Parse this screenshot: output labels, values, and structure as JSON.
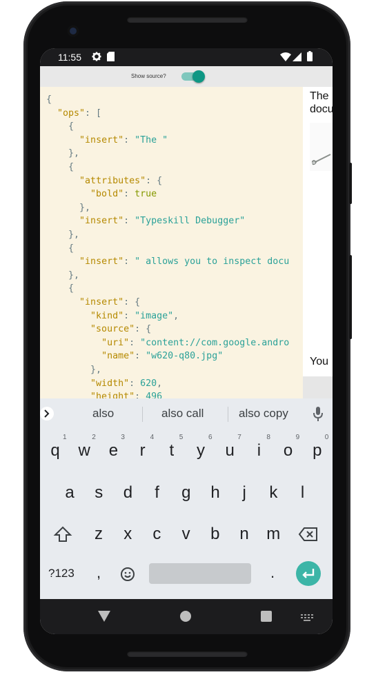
{
  "status": {
    "time": "11:55",
    "icons": [
      "settings-icon",
      "sd-card-icon",
      "wifi-icon",
      "signal-icon",
      "battery-icon"
    ]
  },
  "toggle": {
    "label": "Show source?",
    "checked": true,
    "accent": "#0e9784"
  },
  "source": {
    "lines": [
      [
        {
          "t": "{",
          "c": "p"
        }
      ],
      [
        {
          "t": "  ",
          "c": "p"
        },
        {
          "t": "\"ops\"",
          "c": "k"
        },
        {
          "t": ": [",
          "c": "p"
        }
      ],
      [
        {
          "t": "    {",
          "c": "p"
        }
      ],
      [
        {
          "t": "      ",
          "c": "p"
        },
        {
          "t": "\"insert\"",
          "c": "k"
        },
        {
          "t": ": ",
          "c": "p"
        },
        {
          "t": "\"The \"",
          "c": "s"
        }
      ],
      [
        {
          "t": "    },",
          "c": "p"
        }
      ],
      [
        {
          "t": "    {",
          "c": "p"
        }
      ],
      [
        {
          "t": "      ",
          "c": "p"
        },
        {
          "t": "\"attributes\"",
          "c": "k"
        },
        {
          "t": ": {",
          "c": "p"
        }
      ],
      [
        {
          "t": "        ",
          "c": "p"
        },
        {
          "t": "\"bold\"",
          "c": "k"
        },
        {
          "t": ": ",
          "c": "p"
        },
        {
          "t": "true",
          "c": "b"
        }
      ],
      [
        {
          "t": "      },",
          "c": "p"
        }
      ],
      [
        {
          "t": "      ",
          "c": "p"
        },
        {
          "t": "\"insert\"",
          "c": "k"
        },
        {
          "t": ": ",
          "c": "p"
        },
        {
          "t": "\"Typeskill Debugger\"",
          "c": "s"
        }
      ],
      [
        {
          "t": "    },",
          "c": "p"
        }
      ],
      [
        {
          "t": "    {",
          "c": "p"
        }
      ],
      [
        {
          "t": "      ",
          "c": "p"
        },
        {
          "t": "\"insert\"",
          "c": "k"
        },
        {
          "t": ": ",
          "c": "p"
        },
        {
          "t": "\" allows you to inspect docu",
          "c": "s"
        }
      ],
      [
        {
          "t": "    },",
          "c": "p"
        }
      ],
      [
        {
          "t": "    {",
          "c": "p"
        }
      ],
      [
        {
          "t": "      ",
          "c": "p"
        },
        {
          "t": "\"insert\"",
          "c": "k"
        },
        {
          "t": ": {",
          "c": "p"
        }
      ],
      [
        {
          "t": "        ",
          "c": "p"
        },
        {
          "t": "\"kind\"",
          "c": "k"
        },
        {
          "t": ": ",
          "c": "p"
        },
        {
          "t": "\"image\"",
          "c": "s"
        },
        {
          "t": ",",
          "c": "p"
        }
      ],
      [
        {
          "t": "        ",
          "c": "p"
        },
        {
          "t": "\"source\"",
          "c": "k"
        },
        {
          "t": ": {",
          "c": "p"
        }
      ],
      [
        {
          "t": "          ",
          "c": "p"
        },
        {
          "t": "\"uri\"",
          "c": "k"
        },
        {
          "t": ": ",
          "c": "p"
        },
        {
          "t": "\"content://com.google.andro",
          "c": "s"
        }
      ],
      [
        {
          "t": "          ",
          "c": "p"
        },
        {
          "t": "\"name\"",
          "c": "k"
        },
        {
          "t": ": ",
          "c": "p"
        },
        {
          "t": "\"w620-q80.jpg\"",
          "c": "s"
        }
      ],
      [
        {
          "t": "        },",
          "c": "p"
        }
      ],
      [
        {
          "t": "        ",
          "c": "p"
        },
        {
          "t": "\"width\"",
          "c": "k"
        },
        {
          "t": ": ",
          "c": "p"
        },
        {
          "t": "620",
          "c": "n"
        },
        {
          "t": ",",
          "c": "p"
        }
      ],
      [
        {
          "t": "        ",
          "c": "p"
        },
        {
          "t": "\"height\"",
          "c": "k"
        },
        {
          "t": ": ",
          "c": "p"
        },
        {
          "t": "496",
          "c": "n"
        }
      ]
    ]
  },
  "preview": {
    "line1": "The",
    "line2": "docu",
    "line3": "You"
  },
  "suggestions": {
    "items": [
      "also",
      "also call",
      "also copy"
    ]
  },
  "keyboard": {
    "row1": [
      "q",
      "w",
      "e",
      "r",
      "t",
      "y",
      "u",
      "i",
      "o",
      "p"
    ],
    "row1_hints": [
      "1",
      "2",
      "3",
      "4",
      "5",
      "6",
      "7",
      "8",
      "9",
      "0"
    ],
    "row2": [
      "a",
      "s",
      "d",
      "f",
      "g",
      "h",
      "j",
      "k",
      "l"
    ],
    "row3": [
      "z",
      "x",
      "c",
      "v",
      "b",
      "n",
      "m"
    ],
    "symbols_label": "?123",
    "comma": ",",
    "period": "."
  }
}
